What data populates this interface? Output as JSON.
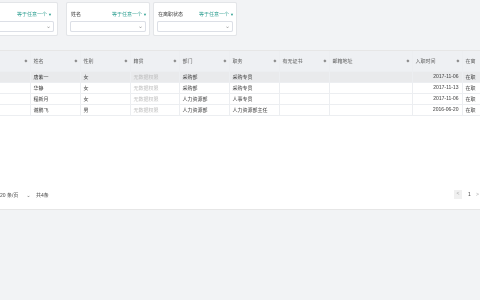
{
  "filters": [
    {
      "label": "",
      "hint": "等于任意一个",
      "selected": ""
    },
    {
      "label": "姓名",
      "hint": "等于任意一个",
      "selected": ""
    },
    {
      "label": "在离职状态",
      "hint": "等于任意一个",
      "selected": ""
    }
  ],
  "table": {
    "columns": [
      "姓名",
      "性别",
      "籍贯",
      "部门",
      "职务",
      "有无证书",
      "邮箱地址",
      "入职时间",
      "在离"
    ],
    "rows": [
      [
        "唐紫一",
        "女",
        "无数据权限",
        "采购部",
        "采购专员",
        "",
        "",
        "2017-11-06",
        "在职"
      ],
      [
        "华静",
        "女",
        "无数据权限",
        "采购部",
        "采购专员",
        "",
        "",
        "2017-11-13",
        "在职"
      ],
      [
        "程新月",
        "女",
        "无数据权限",
        "人力资源部",
        "人事专员",
        "",
        "",
        "2017-11-06",
        "在职"
      ],
      [
        "谢鹏飞",
        "男",
        "无数据权限",
        "人力资源部",
        "人力资源部主任",
        "",
        "",
        "2016-06-20",
        "在职"
      ]
    ]
  },
  "pager": {
    "page_size": "20 条/页",
    "total": "共4条",
    "prev": "<",
    "page": "1",
    "next": ">"
  }
}
